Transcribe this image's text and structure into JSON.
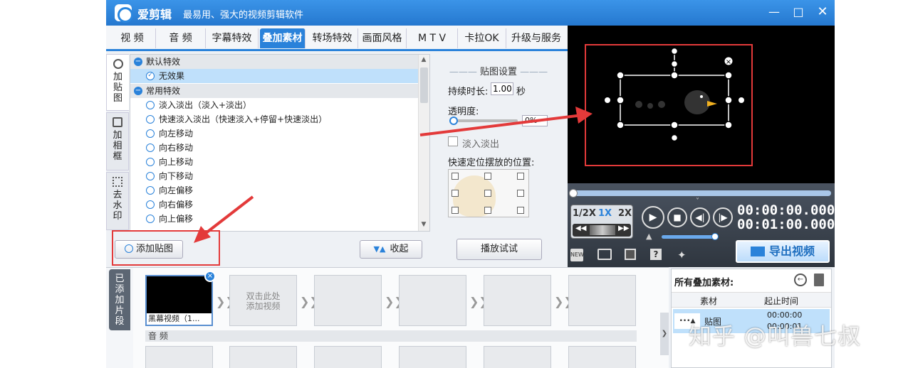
{
  "app": {
    "title": "爱剪辑",
    "subtitle": "最易用、强大的视频剪辑软件"
  },
  "tabs": [
    {
      "label": "视 频"
    },
    {
      "label": "音 频"
    },
    {
      "label": "字幕特效"
    },
    {
      "label": "叠加素材"
    },
    {
      "label": "转场特效"
    },
    {
      "label": "画面风格"
    },
    {
      "label": "M T V"
    },
    {
      "label": "卡拉OK"
    },
    {
      "label": "升级与服务"
    }
  ],
  "side_tabs": [
    {
      "label": "加贴图"
    },
    {
      "label": "加相框"
    },
    {
      "label": "去水印"
    }
  ],
  "effects": {
    "group_default": "默认特效",
    "no_effect": "无效果",
    "group_common": "常用特效",
    "items": [
      "淡入淡出（淡入+淡出）",
      "快速淡入淡出（快速淡入+停留+快速淡出）",
      "向左移动",
      "向右移动",
      "向上移动",
      "向下移动",
      "向左偏移",
      "向右偏移",
      "向上偏移"
    ]
  },
  "buttons": {
    "add_sticker": "添加贴图",
    "collapse": "收起",
    "preview": "播放试试",
    "export": "导出视频"
  },
  "settings": {
    "title": "贴图设置",
    "duration_label": "持续时长:",
    "duration_value": "1.00",
    "duration_unit": "秒",
    "opacity_label": "透明度:",
    "opacity_value": "0%",
    "opacity_level": 0,
    "fade_label": "淡入淡出",
    "position_label": "快速定位摆放的位置:"
  },
  "player": {
    "speed_half": "1/2X",
    "speed_1x": "1X",
    "speed_2x": "2X",
    "time_current": "00:00:00.000",
    "time_total": "00:01:00.000"
  },
  "timeline": {
    "section_label": "已添加片段",
    "clip1_label": "黑幕视频（1...",
    "placeholder": "双击此处添加视频",
    "audio_label": "音 频"
  },
  "overlay_list": {
    "title": "所有叠加素材:",
    "col_material": "素材",
    "col_time": "起止时间",
    "row_name": "贴图",
    "row_start": "00:00:00",
    "row_end": "00:00:01"
  },
  "watermark": "知乎 @叫兽七叔",
  "colors": {
    "accent": "#2a82da",
    "annotation": "#e33a3a"
  }
}
